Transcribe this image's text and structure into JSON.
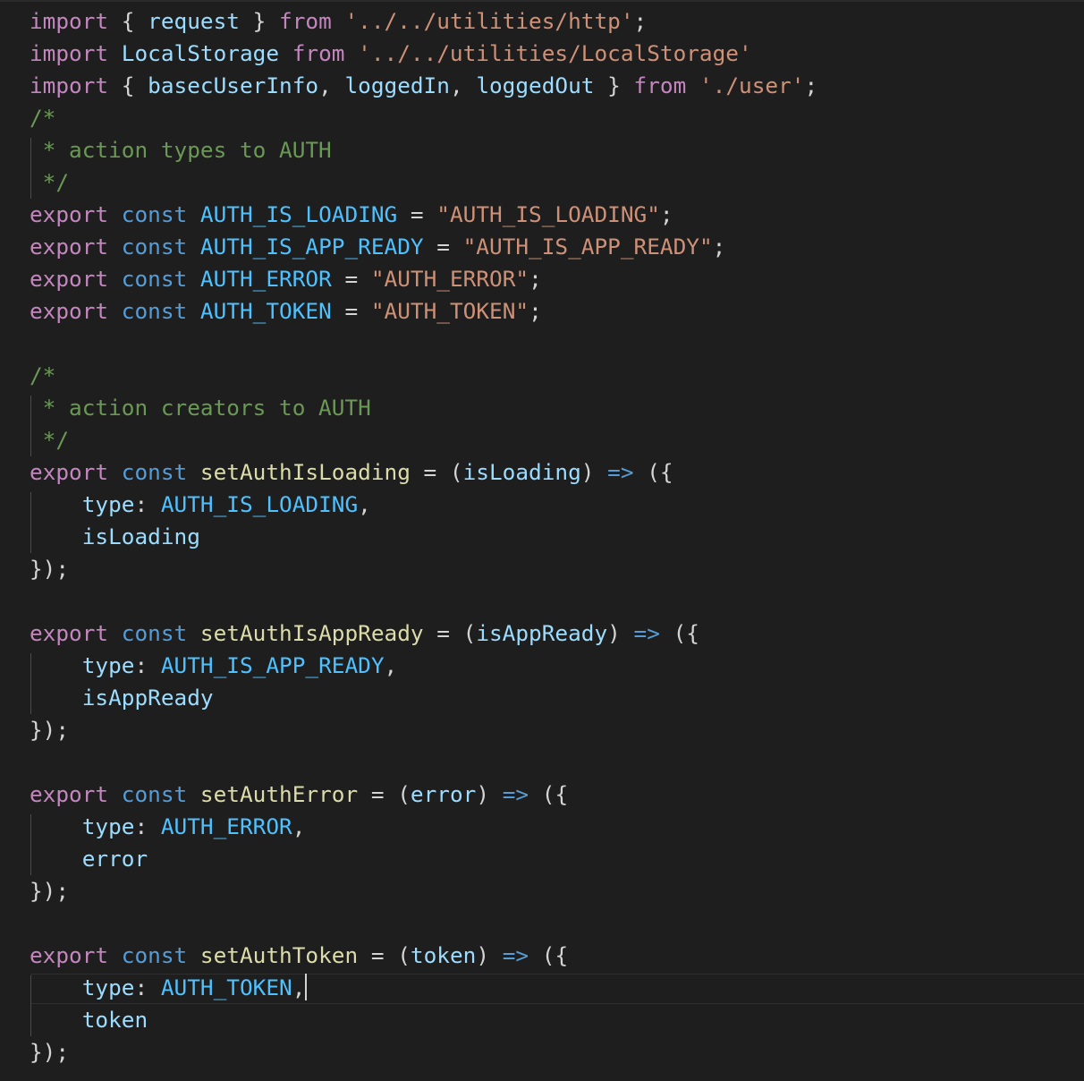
{
  "colors": {
    "background": "#1e1e1e",
    "keyword": "#c586c0",
    "storage": "#569cd6",
    "variable": "#9cdcfe",
    "constant": "#4fc1ff",
    "function": "#dcdcaa",
    "string": "#ce9178",
    "comment": "#6a9955",
    "punctuation": "#d4d4d4"
  },
  "cursor": {
    "line": 31,
    "after_text": "type: AUTH_TOKEN,"
  },
  "lines": [
    [
      [
        "keyword",
        "import"
      ],
      [
        "punct",
        " { "
      ],
      [
        "variable",
        "request"
      ],
      [
        "punct",
        " } "
      ],
      [
        "keyword",
        "from"
      ],
      [
        "plain",
        " "
      ],
      [
        "string",
        "'../../utilities/http'"
      ],
      [
        "punct",
        ";"
      ]
    ],
    [
      [
        "keyword",
        "import"
      ],
      [
        "plain",
        " "
      ],
      [
        "variable",
        "LocalStorage"
      ],
      [
        "plain",
        " "
      ],
      [
        "keyword",
        "from"
      ],
      [
        "plain",
        " "
      ],
      [
        "string",
        "'../../utilities/LocalStorage'"
      ]
    ],
    [
      [
        "keyword",
        "import"
      ],
      [
        "punct",
        " { "
      ],
      [
        "variable",
        "basecUserInfo"
      ],
      [
        "punct",
        ", "
      ],
      [
        "variable",
        "loggedIn"
      ],
      [
        "punct",
        ", "
      ],
      [
        "variable",
        "loggedOut"
      ],
      [
        "punct",
        " } "
      ],
      [
        "keyword",
        "from"
      ],
      [
        "plain",
        " "
      ],
      [
        "string",
        "'./user'"
      ],
      [
        "punct",
        ";"
      ]
    ],
    [
      [
        "comment",
        "/*"
      ]
    ],
    [
      [
        "comment",
        " * action types to AUTH"
      ]
    ],
    [
      [
        "comment",
        " */"
      ]
    ],
    [
      [
        "keyword",
        "export"
      ],
      [
        "plain",
        " "
      ],
      [
        "storage",
        "const"
      ],
      [
        "plain",
        " "
      ],
      [
        "constant",
        "AUTH_IS_LOADING"
      ],
      [
        "punct",
        " = "
      ],
      [
        "string",
        "\"AUTH_IS_LOADING\""
      ],
      [
        "punct",
        ";"
      ]
    ],
    [
      [
        "keyword",
        "export"
      ],
      [
        "plain",
        " "
      ],
      [
        "storage",
        "const"
      ],
      [
        "plain",
        " "
      ],
      [
        "constant",
        "AUTH_IS_APP_READY"
      ],
      [
        "punct",
        " = "
      ],
      [
        "string",
        "\"AUTH_IS_APP_READY\""
      ],
      [
        "punct",
        ";"
      ]
    ],
    [
      [
        "keyword",
        "export"
      ],
      [
        "plain",
        " "
      ],
      [
        "storage",
        "const"
      ],
      [
        "plain",
        " "
      ],
      [
        "constant",
        "AUTH_ERROR"
      ],
      [
        "punct",
        " = "
      ],
      [
        "string",
        "\"AUTH_ERROR\""
      ],
      [
        "punct",
        ";"
      ]
    ],
    [
      [
        "keyword",
        "export"
      ],
      [
        "plain",
        " "
      ],
      [
        "storage",
        "const"
      ],
      [
        "plain",
        " "
      ],
      [
        "constant",
        "AUTH_TOKEN"
      ],
      [
        "punct",
        " = "
      ],
      [
        "string",
        "\"AUTH_TOKEN\""
      ],
      [
        "punct",
        ";"
      ]
    ],
    [],
    [
      [
        "comment",
        "/*"
      ]
    ],
    [
      [
        "comment",
        " * action creators to AUTH"
      ]
    ],
    [
      [
        "comment",
        " */"
      ]
    ],
    [
      [
        "keyword",
        "export"
      ],
      [
        "plain",
        " "
      ],
      [
        "storage",
        "const"
      ],
      [
        "plain",
        " "
      ],
      [
        "function",
        "setAuthIsLoading"
      ],
      [
        "punct",
        " = ("
      ],
      [
        "variable",
        "isLoading"
      ],
      [
        "punct",
        ") "
      ],
      [
        "arrow",
        "=>"
      ],
      [
        "punct",
        " ({"
      ]
    ],
    [
      [
        "plain",
        "    "
      ],
      [
        "variable",
        "type"
      ],
      [
        "punct",
        ": "
      ],
      [
        "constant",
        "AUTH_IS_LOADING"
      ],
      [
        "punct",
        ","
      ]
    ],
    [
      [
        "plain",
        "    "
      ],
      [
        "variable",
        "isLoading"
      ]
    ],
    [
      [
        "punct",
        "});"
      ]
    ],
    [],
    [
      [
        "keyword",
        "export"
      ],
      [
        "plain",
        " "
      ],
      [
        "storage",
        "const"
      ],
      [
        "plain",
        " "
      ],
      [
        "function",
        "setAuthIsAppReady"
      ],
      [
        "punct",
        " = ("
      ],
      [
        "variable",
        "isAppReady"
      ],
      [
        "punct",
        ") "
      ],
      [
        "arrow",
        "=>"
      ],
      [
        "punct",
        " ({"
      ]
    ],
    [
      [
        "plain",
        "    "
      ],
      [
        "variable",
        "type"
      ],
      [
        "punct",
        ": "
      ],
      [
        "constant",
        "AUTH_IS_APP_READY"
      ],
      [
        "punct",
        ","
      ]
    ],
    [
      [
        "plain",
        "    "
      ],
      [
        "variable",
        "isAppReady"
      ]
    ],
    [
      [
        "punct",
        "});"
      ]
    ],
    [],
    [
      [
        "keyword",
        "export"
      ],
      [
        "plain",
        " "
      ],
      [
        "storage",
        "const"
      ],
      [
        "plain",
        " "
      ],
      [
        "function",
        "setAuthError"
      ],
      [
        "punct",
        " = ("
      ],
      [
        "variable",
        "error"
      ],
      [
        "punct",
        ") "
      ],
      [
        "arrow",
        "=>"
      ],
      [
        "punct",
        " ({"
      ]
    ],
    [
      [
        "plain",
        "    "
      ],
      [
        "variable",
        "type"
      ],
      [
        "punct",
        ": "
      ],
      [
        "constant",
        "AUTH_ERROR"
      ],
      [
        "punct",
        ","
      ]
    ],
    [
      [
        "plain",
        "    "
      ],
      [
        "variable",
        "error"
      ]
    ],
    [
      [
        "punct",
        "});"
      ]
    ],
    [],
    [
      [
        "keyword",
        "export"
      ],
      [
        "plain",
        " "
      ],
      [
        "storage",
        "const"
      ],
      [
        "plain",
        " "
      ],
      [
        "function",
        "setAuthToken"
      ],
      [
        "punct",
        " = ("
      ],
      [
        "variable",
        "token"
      ],
      [
        "punct",
        ") "
      ],
      [
        "arrow",
        "=>"
      ],
      [
        "punct",
        " ({"
      ]
    ],
    [
      [
        "plain",
        "    "
      ],
      [
        "variable",
        "type"
      ],
      [
        "punct",
        ": "
      ],
      [
        "constant",
        "AUTH_TOKEN"
      ],
      [
        "punct",
        ","
      ]
    ],
    [
      [
        "plain",
        "    "
      ],
      [
        "variable",
        "token"
      ]
    ],
    [
      [
        "punct",
        "});"
      ]
    ]
  ]
}
